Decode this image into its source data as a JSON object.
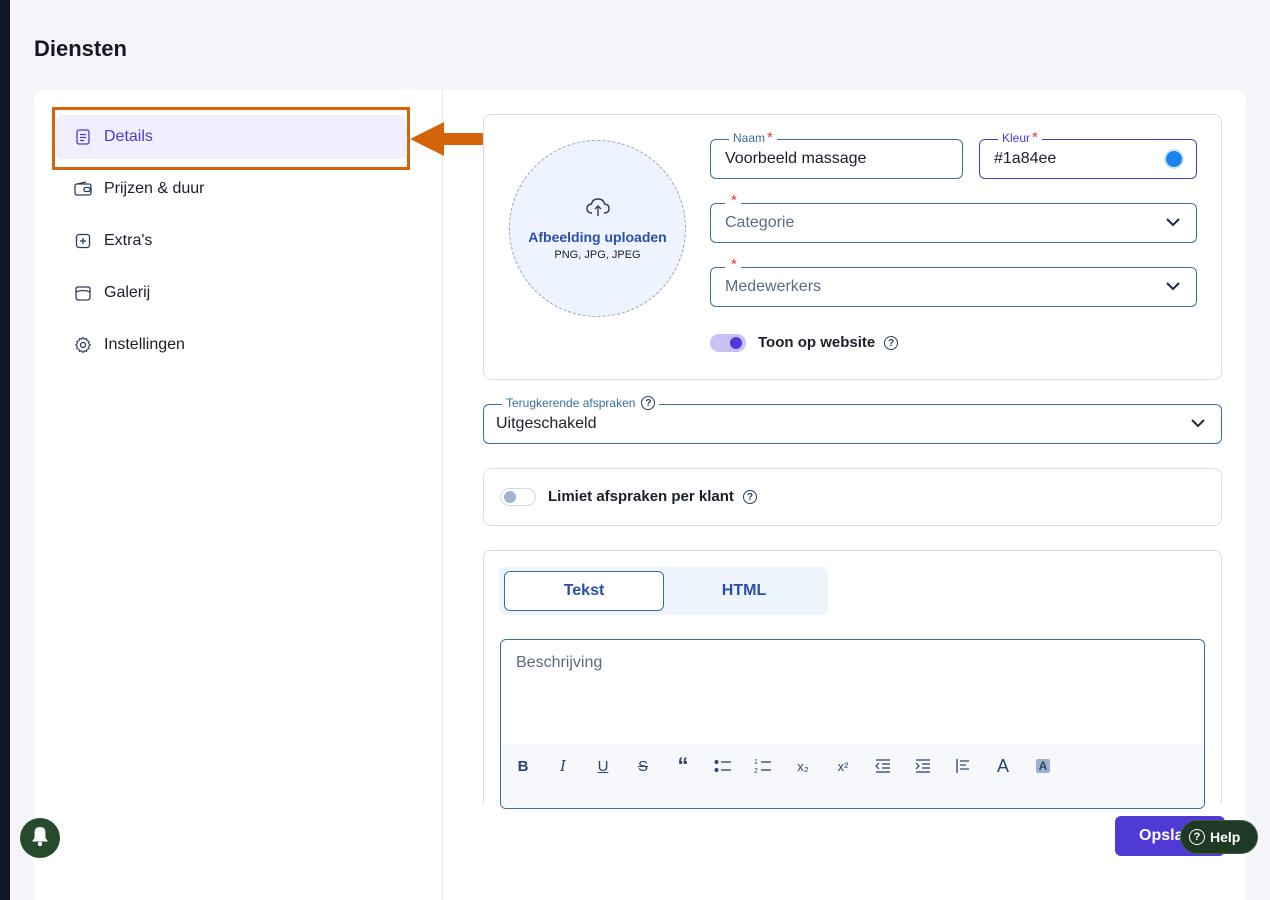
{
  "page": {
    "title": "Diensten"
  },
  "sidebar": {
    "items": [
      {
        "label": "Details",
        "icon": "document-icon"
      },
      {
        "label": "Prijzen & duur",
        "icon": "wallet-icon"
      },
      {
        "label": "Extra's",
        "icon": "plus-square-icon"
      },
      {
        "label": "Galerij",
        "icon": "gallery-icon"
      },
      {
        "label": "Instellingen",
        "icon": "gear-icon"
      }
    ]
  },
  "upload": {
    "label": "Afbeelding uploaden",
    "formats": "PNG, JPG, JPEG"
  },
  "form": {
    "naam": {
      "label": "Naam",
      "value": "Voorbeeld massage",
      "required": "*"
    },
    "kleur": {
      "label": "Kleur",
      "value": "#1a84ee",
      "required": "*"
    },
    "categorie": {
      "placeholder": "Categorie",
      "required": "*"
    },
    "medewerkers": {
      "placeholder": "Medewerkers",
      "required": "*"
    },
    "toon_op_website": {
      "label": "Toon op website",
      "enabled": true
    },
    "terugkerende": {
      "label": "Terugkerende afspraken",
      "value": "Uitgeschakeld"
    },
    "limiet": {
      "label": "Limiet afspraken per klant",
      "enabled": false
    }
  },
  "editor": {
    "tabs": [
      "Tekst",
      "HTML"
    ],
    "active_tab": "Tekst",
    "placeholder": "Beschrijving"
  },
  "footer": {
    "save_label": "Opsla",
    "help_label": "Help"
  },
  "colors": {
    "accent": "#4f3ad6",
    "brand_color_value": "#1a84ee",
    "highlight": "#d4640c"
  }
}
